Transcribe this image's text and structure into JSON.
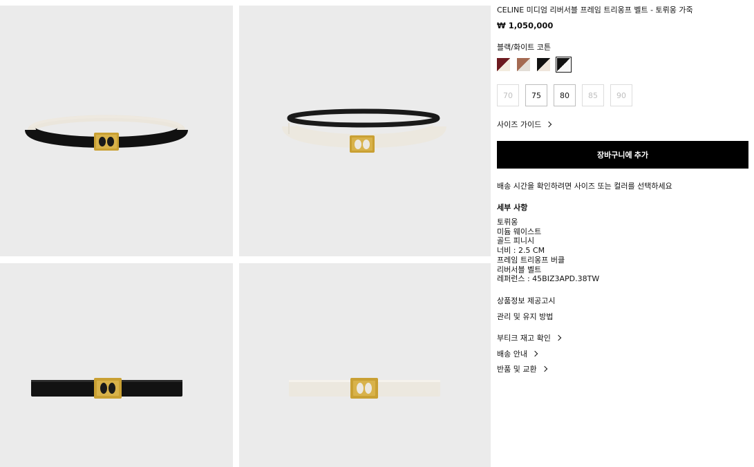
{
  "product": {
    "title": "CELINE 미디엄 리버서블 프레임 트리옹프 벨트 - 토뤼옹 가죽",
    "price": "₩ 1,050,000",
    "color_name": "블랙/화이트 코튼",
    "swatches": [
      {
        "name": "burgundy-cream",
        "color1": "#6d1a1f",
        "color2": "#f3ecdf",
        "selected": false
      },
      {
        "name": "tan-grey",
        "color1": "#a46a52",
        "color2": "#e3ded7",
        "selected": false
      },
      {
        "name": "black-cream",
        "color1": "#111111",
        "color2": "#efe6dc",
        "selected": false
      },
      {
        "name": "black-white",
        "color1": "#111111",
        "color2": "#f7f7f7",
        "selected": true
      }
    ],
    "sizes": [
      {
        "label": "70",
        "available": false
      },
      {
        "label": "75",
        "available": true
      },
      {
        "label": "80",
        "available": true
      },
      {
        "label": "85",
        "available": false
      },
      {
        "label": "90",
        "available": false
      }
    ],
    "size_guide": "사이즈 가이드",
    "add_to_cart": "장바구니에 추가",
    "delivery_note": "배송 시간을 확인하려면 사이즈 또는 컬러를 선택하세요",
    "details_heading": "세부 사항",
    "details": [
      "토뤼옹",
      "미듐 웨이스트",
      "골드 피니시",
      "너비 : 2.5 CM",
      "프레임 트리옹프 버클",
      "리버서블 벨트",
      "레퍼런스 : 45BIZ3APD.38TW"
    ],
    "info_notice": "상품정보 제공고시",
    "care": "관리 및 유지 방법",
    "boutique_stock": "부티크 재고 확인",
    "shipping": "배송 안내",
    "returns": "반품 및 교환"
  },
  "gallery": {
    "background": "#ebebeb",
    "images": [
      "belt-coiled-black-outer",
      "belt-coiled-white-outer",
      "belt-flat-black",
      "belt-flat-white"
    ]
  },
  "colors": {
    "black": "#000000",
    "gold": "#c9a033",
    "cream": "#ece8df"
  }
}
